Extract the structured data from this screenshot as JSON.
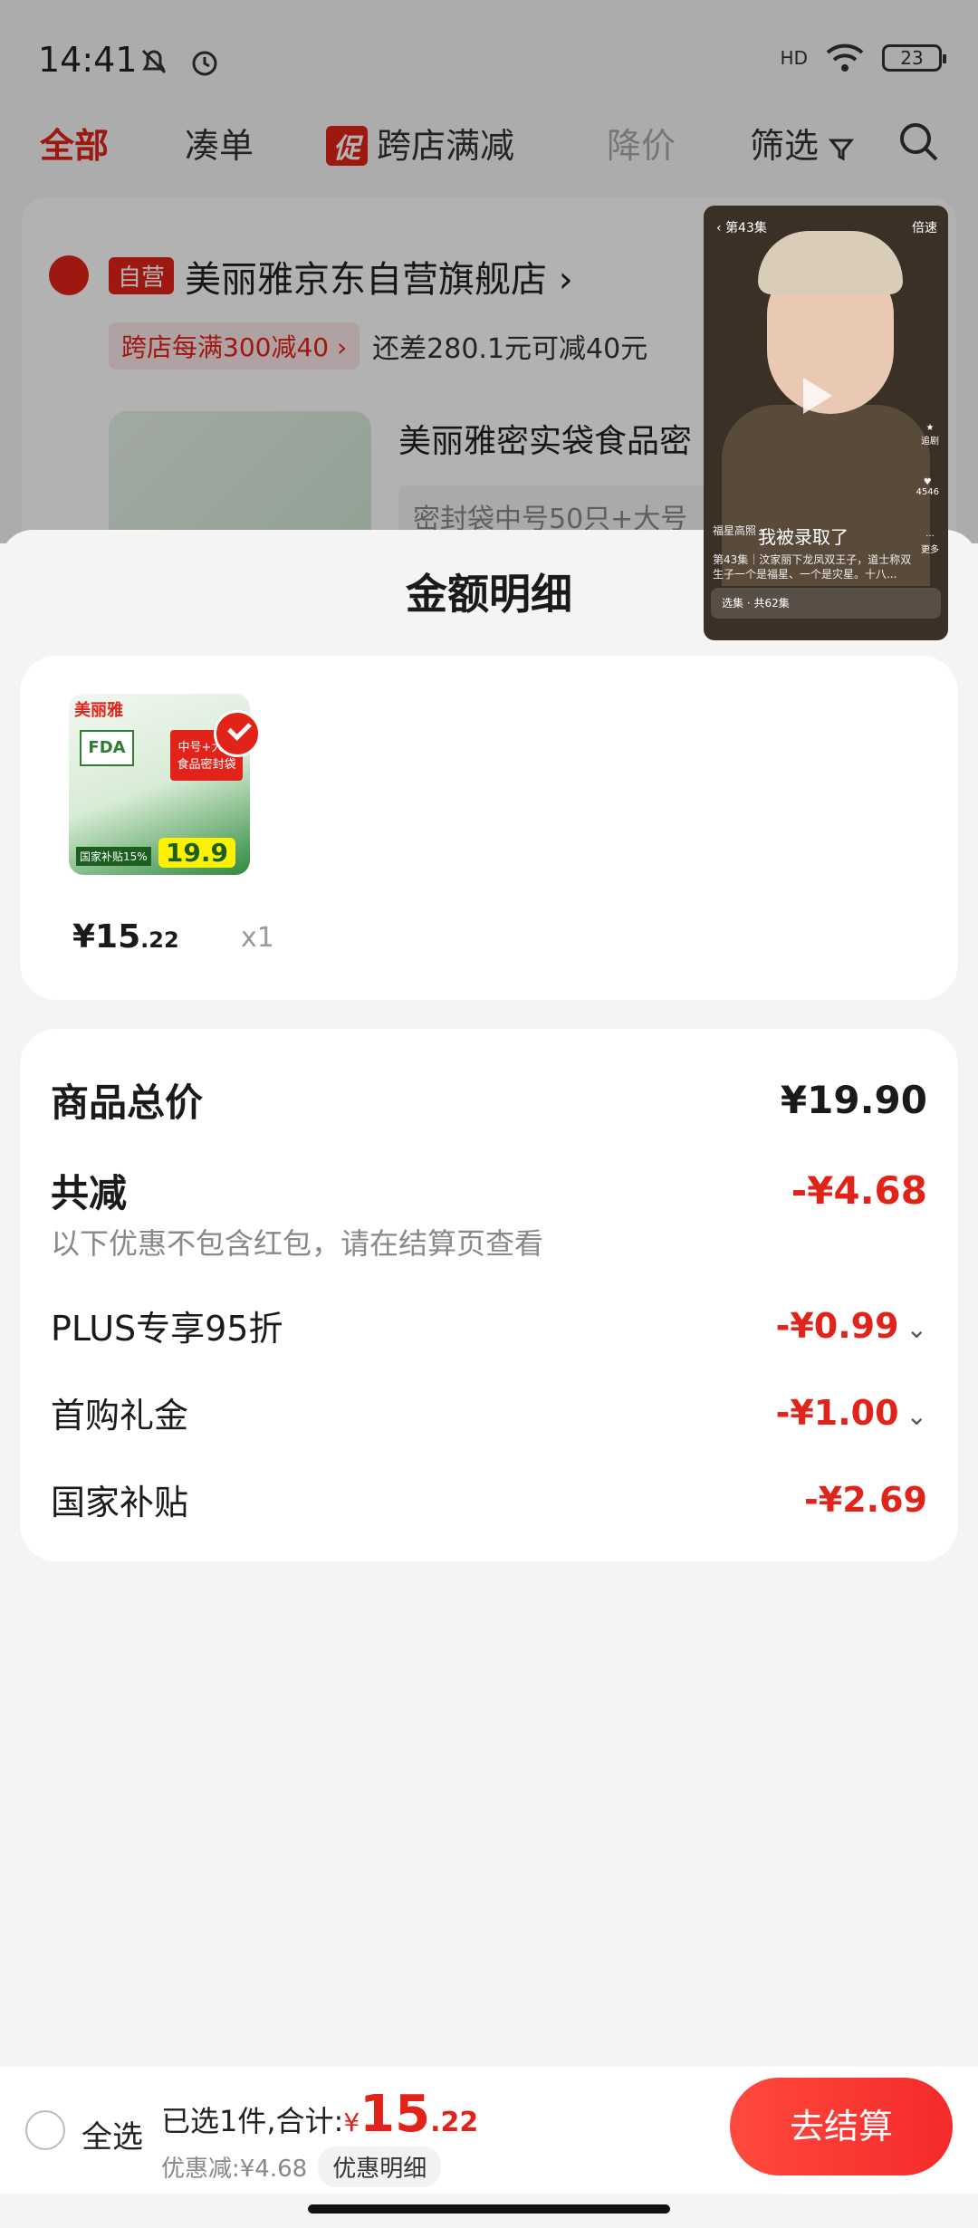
{
  "status": {
    "time": "14:41",
    "battery": "23",
    "network": "HD"
  },
  "tabs": [
    {
      "label": "全部"
    },
    {
      "label": "凑单"
    },
    {
      "label": "跨店满减",
      "badge": "促"
    },
    {
      "label": "降价"
    },
    {
      "label": "筛选"
    }
  ],
  "store": {
    "tag": "自营",
    "name": "美丽雅京东自营旗舰店 ›",
    "promo_chip": "跨店每满300减40 ›",
    "promo_text": "还差280.1元可减40元",
    "product_title": "美丽雅密实袋食品密",
    "product_spec": "密封袋中号50只+大号"
  },
  "video": {
    "episode": "第43集",
    "speed": "倍速",
    "caption": "我被录取了",
    "author": "福星高照 ›",
    "desc": "第43集｜汶家丽下龙凤双王子，道士称双生子一个是福星、一个是灾星。十八...",
    "bar": "选集 · 共62集",
    "likes": "4546",
    "side_fav": "追剧",
    "side_more": "更多"
  },
  "sheet": {
    "title": "金额明细"
  },
  "item": {
    "brand": "美丽雅",
    "fda": "FDA",
    "tag": "中号+大号 食品密封袋",
    "img_price": "19.9",
    "img_sub": "国家补贴15%",
    "price_yen": "¥15",
    "price_dec": ".22",
    "qty": "x1"
  },
  "details": {
    "total_label": "商品总价",
    "total_value": "¥19.90",
    "discount_label": "共减",
    "discount_value": "-¥4.68",
    "note": "以下优惠不包含红包，请在结算页查看",
    "lines": [
      {
        "label": "PLUS专享95折",
        "value": "-¥0.99"
      },
      {
        "label": "首购礼金",
        "value": "-¥1.00"
      },
      {
        "label": "国家补贴",
        "value": "-¥2.69"
      }
    ]
  },
  "bottom": {
    "select_all": "全选",
    "selected": "已选1件,合计:",
    "yen": "¥",
    "amount_int": "15",
    "amount_dec": ".22",
    "discount": "优惠减:¥4.68",
    "detail_btn": "优惠明细",
    "checkout": "去结算"
  },
  "colors": {
    "accent": "#e2231a",
    "background": "#f4f4f4"
  }
}
